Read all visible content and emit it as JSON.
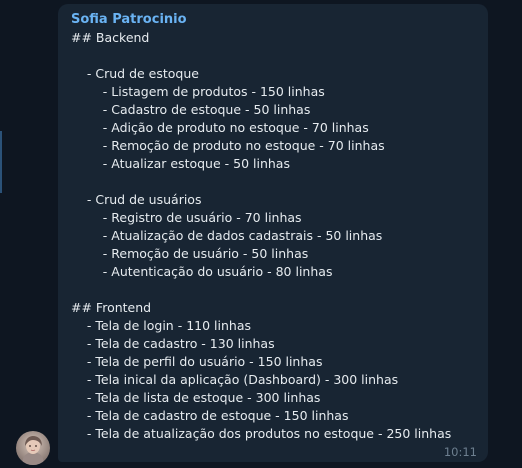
{
  "message": {
    "sender": "Sofia Patrocinio",
    "time": "10:11",
    "lines": [
      "## Backend",
      "",
      "    - Crud de estoque",
      "        - Listagem de produtos - 150 linhas",
      "        - Cadastro de estoque - 50 linhas",
      "        - Adição de produto no estoque - 70 linhas",
      "        - Remoção de produto no estoque - 70 linhas",
      "        - Atualizar estoque - 50 linhas",
      "",
      "    - Crud de usuários",
      "        - Registro de usuário - 70 linhas",
      "        - Atualização de dados cadastrais - 50 linhas",
      "        - Remoção de usuário - 50 linhas",
      "        - Autenticação do usuário - 80 linhas",
      "",
      "## Frontend",
      "    - Tela de login - 110 linhas",
      "    - Tela de cadastro - 130 linhas",
      "    - Tela de perfil do usuário - 150 linhas",
      "    - Tela inical da aplicação (Dashboard) - 300 linhas",
      "    - Tela de lista de estoque - 300 linhas",
      "    - Tela de cadastro de estoque - 150 linhas",
      "    - Tela de atualização dos produtos no estoque - 250 linhas"
    ]
  },
  "colors": {
    "background": "#0e1621",
    "bubble": "#182533",
    "sender_name": "#6ab3f3",
    "text": "#e6ebef",
    "timestamp": "#6d7f8f"
  },
  "avatar": {
    "icon": "user-photo-avatar"
  }
}
